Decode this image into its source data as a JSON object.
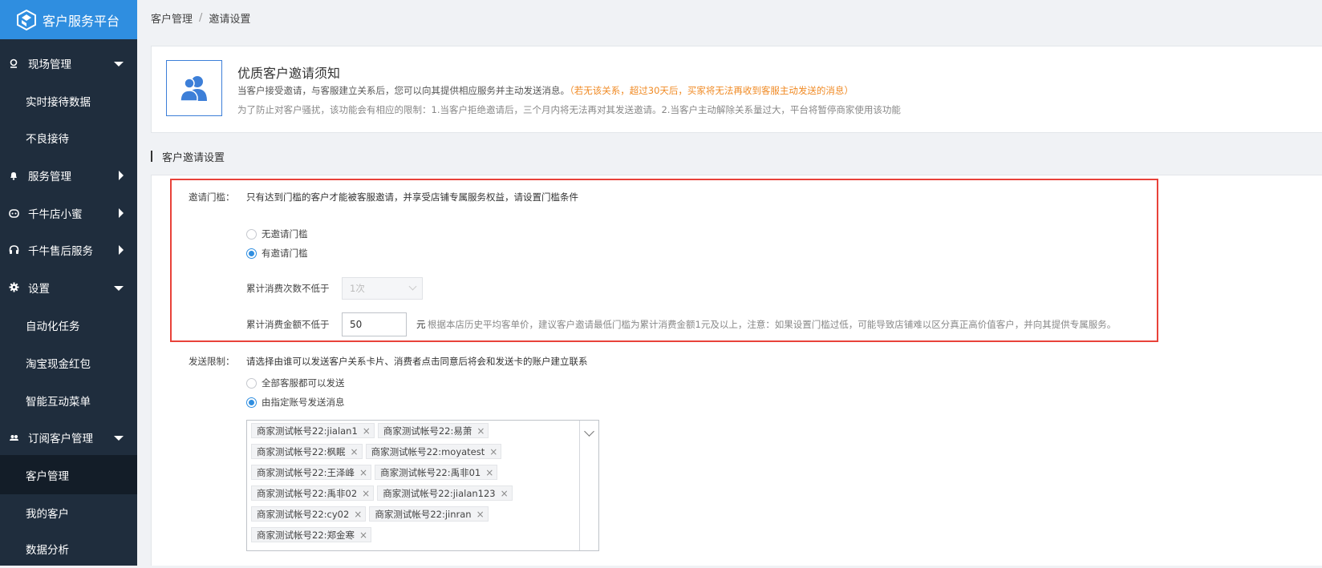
{
  "brand": {
    "title": "客户服务平台"
  },
  "sidebar": {
    "items": [
      {
        "label": "现场管理",
        "icon": "location-icon",
        "kind": "group",
        "caret": "down"
      },
      {
        "label": "实时接待数据",
        "kind": "sub"
      },
      {
        "label": "不良接待",
        "kind": "sub"
      },
      {
        "label": "服务管理",
        "icon": "bell-icon",
        "kind": "group",
        "caret": "right"
      },
      {
        "label": "千牛店小蜜",
        "icon": "robot-icon",
        "kind": "group",
        "caret": "right"
      },
      {
        "label": "千牛售后服务",
        "icon": "headset-icon",
        "kind": "group",
        "caret": "right"
      },
      {
        "label": "设置",
        "icon": "gear-icon",
        "kind": "group",
        "caret": "down"
      },
      {
        "label": "自动化任务",
        "kind": "sub"
      },
      {
        "label": "淘宝现金红包",
        "kind": "sub"
      },
      {
        "label": "智能互动菜单",
        "kind": "sub"
      },
      {
        "label": "订阅客户管理",
        "icon": "users-icon",
        "kind": "group",
        "caret": "down"
      },
      {
        "label": "客户管理",
        "kind": "sub",
        "active": true
      },
      {
        "label": "我的客户",
        "kind": "sub"
      },
      {
        "label": "数据分析",
        "kind": "sub"
      }
    ]
  },
  "breadcrumb": {
    "parent": "客户管理",
    "separator": "/",
    "current": "邀请设置"
  },
  "notice": {
    "title": "优质客户邀请须知",
    "line1": "当客户接受邀请，与客服建立关系后，您可以向其提供相应服务并主动发送消息。",
    "line1_warn": "（若无该关系，超过30天后，买家将无法再收到客服主动发送的消息）",
    "line2": "为了防止对客户骚扰，该功能会有相应的限制：1.当客户拒绝邀请后，三个月内将无法再对其发送邀请。2.当客户主动解除关系量过大，平台将暂停商家使用该功能"
  },
  "section": {
    "title": "客户邀请设置"
  },
  "threshold": {
    "label": "邀请门槛：",
    "desc": "只有达到门槛的客户才能被客服邀请，并享受店铺专属服务权益，请设置门槛条件",
    "option_none": "无邀请门槛",
    "option_has": "有邀请门槛",
    "count_label": "累计消费次数不低于",
    "count_value": "1次",
    "amount_label": "累计消费金额不低于",
    "amount_value": "50",
    "amount_unit": "元",
    "amount_hint": "根据本店历史平均客单价，建议客户邀请最低门槛为累计消费金额1元及以上，注意：如果设置门槛过低，可能导致店铺难以区分真正高价值客户，并向其提供专属服务。"
  },
  "send_limit": {
    "label": "发送限制：",
    "desc": "请选择由谁可以发送客户关系卡片、消费者点击同意后将会和发送卡的账户建立联系",
    "option_all": "全部客服都可以发送",
    "option_specified": "由指定账号发送消息",
    "accounts": [
      [
        "商家测试帐号22:jialan1",
        "商家测试帐号22:易萧"
      ],
      [
        "商家测试帐号22:枫眠",
        "商家测试帐号22:moyatest"
      ],
      [
        "商家测试帐号22:王泽峰",
        "商家测试帐号22:禹非01"
      ],
      [
        "商家测试帐号22:禹非02",
        "商家测试帐号22:jialan123"
      ],
      [
        "商家测试帐号22:cy02",
        "商家测试帐号22:jinran"
      ],
      [
        "商家测试帐号22:郑金寒"
      ]
    ]
  },
  "colors": {
    "brand_blue": "#2f8ee0",
    "sidebar_bg": "#1f2d3d",
    "highlight_red": "#e8423a",
    "warn_orange": "#f08a24"
  }
}
